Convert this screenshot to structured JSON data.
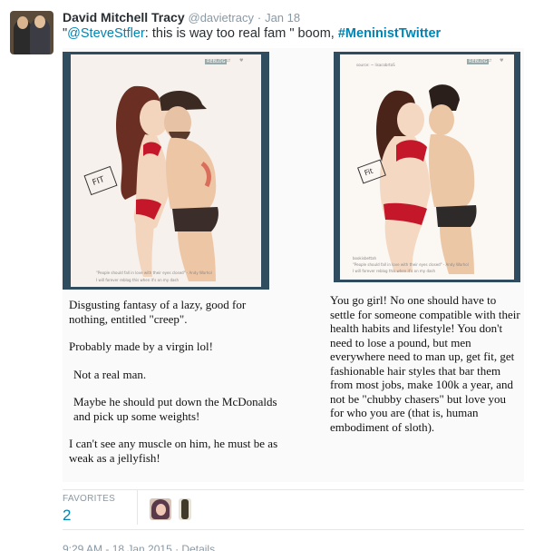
{
  "tweet": {
    "fullname": "David Mitchell Tracy",
    "handle": "@davietracy",
    "separator": "·",
    "date": "Jan 18",
    "text_open": "\"",
    "mention": "@SteveStfler",
    "text_middle": ": this is way too real fam \" boom, ",
    "hashtag": "#MeninistTwitter"
  },
  "media": {
    "left_panel": {
      "watermark": "FIT",
      "footer_line1": "\"People should fall in love with their eyes closed\" - Andy Warhol",
      "footer_line2": "I will forever reblog this when it's on my dash",
      "caption": [
        "Disgusting fantasy of a lazy, good for nothing, entitled \"creep\".",
        "Probably made by a virgin lol!",
        "Not a real man.",
        "Maybe he should put down the McDonalds and pick up some weights!",
        "I can't see any muscle on him, he must be as weak as a jellyfish!"
      ]
    },
    "right_panel": {
      "header_left": "source: ~ lisacobrtaS",
      "watermark": "Fit",
      "footer_line1": "bookisbettah",
      "footer_line2": "\"People should fall in love with their eyes closed\" - Andy Warhol",
      "footer_line3": "I will forever reblog this when it's on my dash",
      "caption": "You go girl! No one should have to settle for someone compatible with their health habits and lifestyle! You don't need to lose a pound, but men everywhere need to man up, get fit, get fashionable hair styles that bar them from most jobs, make 100k a year, and not be \"chubby chasers\" but love you for who you are (that is, human embodiment of sloth)."
    },
    "tag_label": "REBLOG"
  },
  "stats": {
    "favorites_label": "FAVORITES",
    "favorites_count": "2"
  },
  "meta": {
    "timestamp": "9:29 AM - 18 Jan 2015 · Details"
  },
  "colors": {
    "link": "#0084b4",
    "muted": "#8899a6",
    "panel_frame": "#2f4d5f"
  }
}
